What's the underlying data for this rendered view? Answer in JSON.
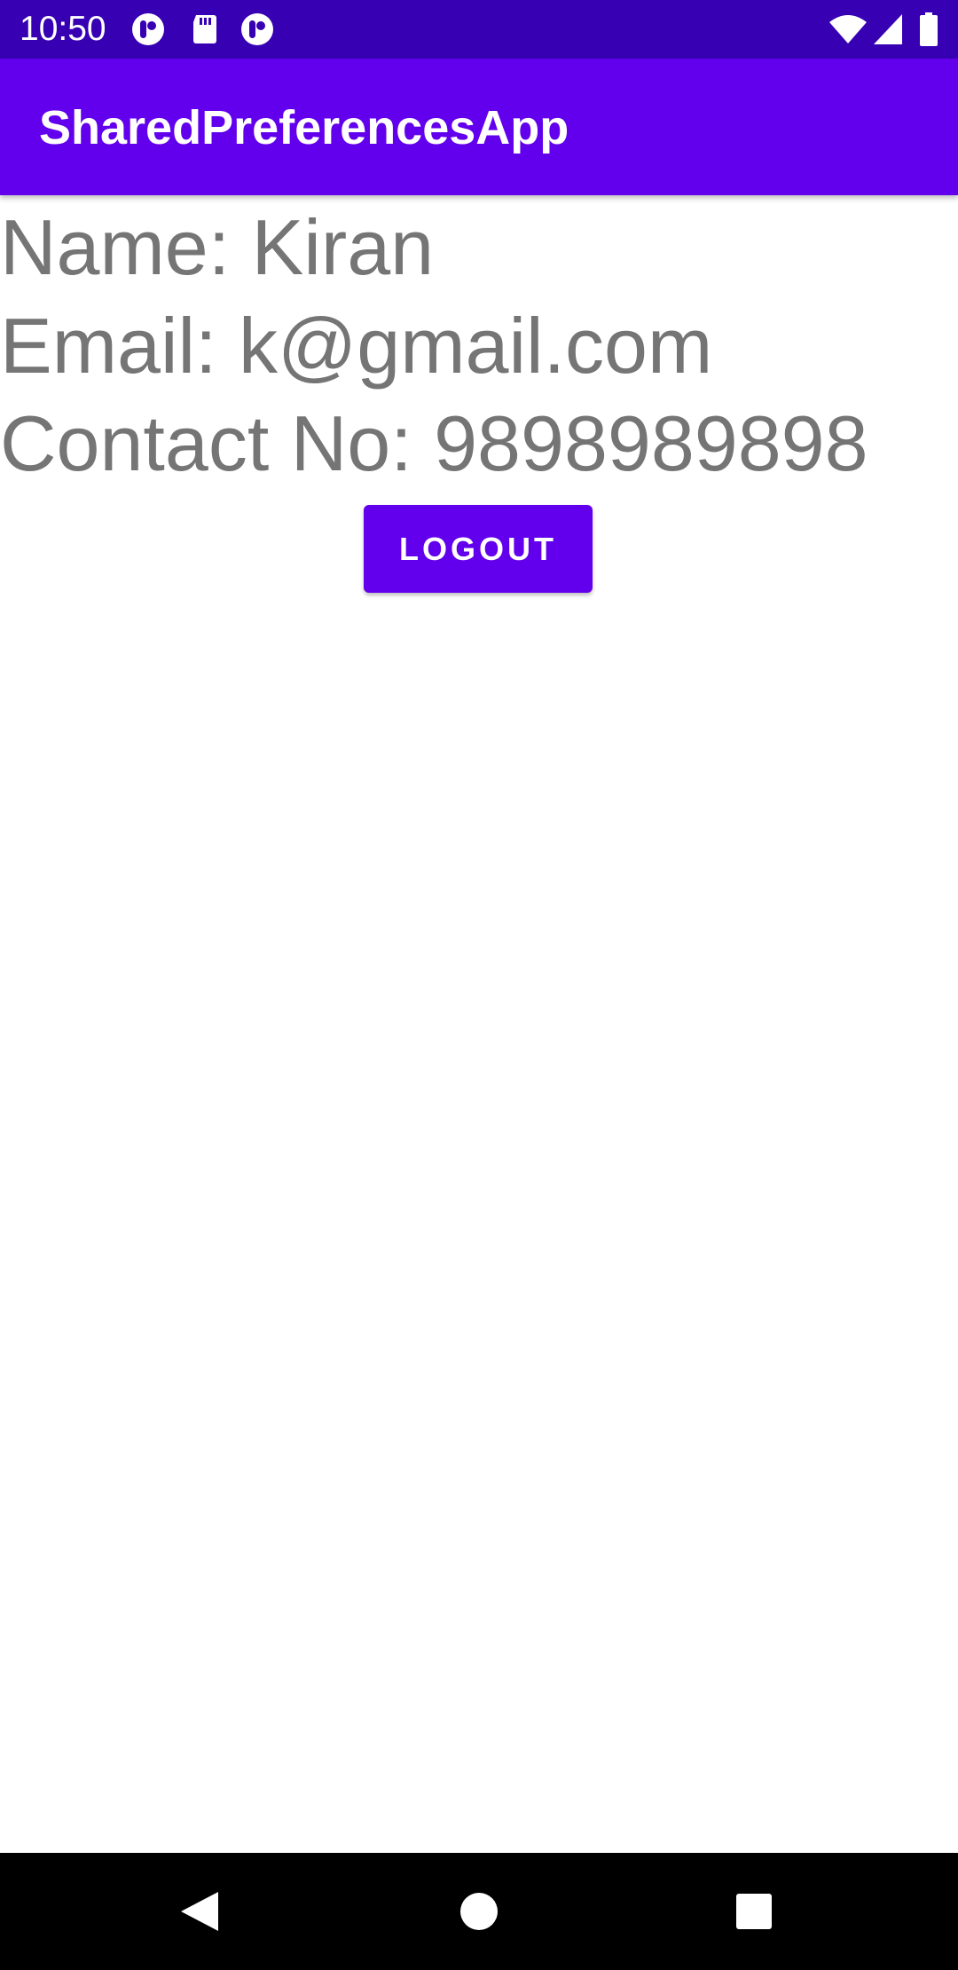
{
  "status_bar": {
    "time": "10:50",
    "left_icons": [
      "notification-app-icon",
      "sd-card-icon",
      "notification-app-icon"
    ],
    "right_icons": [
      "wifi-icon",
      "cell-signal-icon",
      "battery-icon"
    ]
  },
  "app_bar": {
    "title": "SharedPreferencesApp"
  },
  "profile": {
    "name_line": "Name: Kiran",
    "email_line": "Email: k@gmail.com",
    "contact_line": "Contact No: 9898989898"
  },
  "actions": {
    "logout_label": "LOGOUT"
  },
  "nav_bar": {
    "icons": [
      "back-icon",
      "home-icon",
      "recents-icon"
    ]
  },
  "colors": {
    "status_bar": "#3700B3",
    "primary": "#6200EE",
    "text_gray": "#757575",
    "nav_bar": "#000000"
  }
}
